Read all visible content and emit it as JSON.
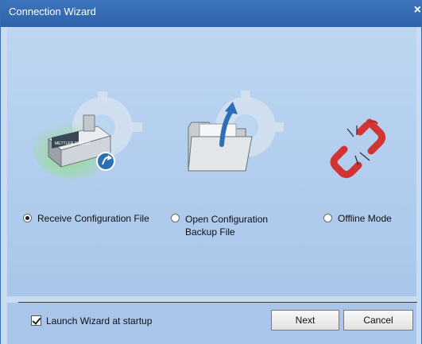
{
  "window": {
    "title": "Connection Wizard",
    "close_glyph": "×"
  },
  "options": [
    {
      "label": "Receive Configuration File",
      "selected": true,
      "icon": "scale-device-icon"
    },
    {
      "label_line1": "Open Configuration",
      "label_line2": "Backup File",
      "selected": false,
      "icon": "open-folder-icon"
    },
    {
      "label": "Offline Mode",
      "selected": false,
      "icon": "broken-link-icon"
    }
  ],
  "device_label": "METTLER TOLEDO",
  "footer": {
    "launch_checkbox_label": "Launch Wizard at startup",
    "launch_checked": true,
    "next_label": "Next",
    "cancel_label": "Cancel"
  },
  "colors": {
    "titlebar": "#3d74bd",
    "content": "#bcd6f1",
    "link_red": "#d23333",
    "arrow_blue": "#2d6fb7"
  }
}
